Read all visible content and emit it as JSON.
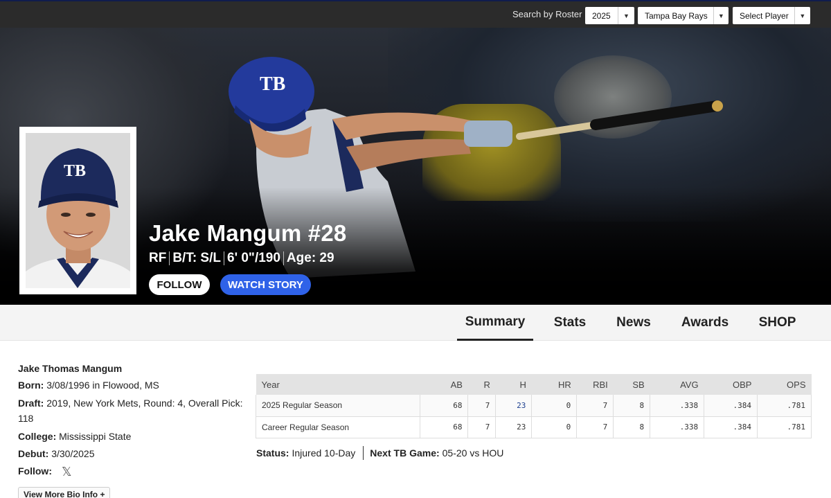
{
  "topbar": {
    "search_label": "Search by Roster",
    "year": "2025",
    "team": "Tampa Bay Rays",
    "player": "Select Player"
  },
  "hero": {
    "name": "Jake Mangum #28",
    "position": "RF",
    "bt": "B/T: S/L",
    "height_weight": "6' 0\"/190",
    "age": "Age: 29",
    "follow_label": "FOLLOW",
    "watch_label": "WATCH STORY",
    "cap_logo": "TB"
  },
  "tabs": [
    {
      "label": "Summary",
      "active": true
    },
    {
      "label": "Stats"
    },
    {
      "label": "News"
    },
    {
      "label": "Awards"
    },
    {
      "label": "SHOP"
    }
  ],
  "bio": {
    "full_name": "Jake Thomas Mangum",
    "born_label": "Born:",
    "born": "3/08/1996 in Flowood, MS",
    "draft_label": "Draft:",
    "draft": "2019, New York Mets, Round: 4, Overall Pick: 118",
    "college_label": "College:",
    "college": "Mississippi State",
    "debut_label": "Debut:",
    "debut": "3/30/2025",
    "follow_label": "Follow:",
    "follow_icon": "x-icon",
    "more_label": "View More Bio Info +"
  },
  "stats_table": {
    "headers": [
      "Year",
      "AB",
      "R",
      "H",
      "HR",
      "RBI",
      "SB",
      "AVG",
      "OBP",
      "OPS"
    ],
    "rows": [
      [
        "2025 Regular Season",
        "68",
        "7",
        "23",
        "0",
        "7",
        "8",
        ".338",
        ".384",
        ".781"
      ],
      [
        "Career Regular Season",
        "68",
        "7",
        "23",
        "0",
        "7",
        "8",
        ".338",
        ".384",
        ".781"
      ]
    ]
  },
  "status": {
    "status_label": "Status:",
    "status_value": "Injured 10-Day",
    "next_label": "Next TB Game:",
    "next_value": "05-20 vs HOU"
  },
  "colors": {
    "watch_button": "#2f62e8",
    "cap_navy": "#1c2a5c",
    "link": "#1d3f8f"
  }
}
